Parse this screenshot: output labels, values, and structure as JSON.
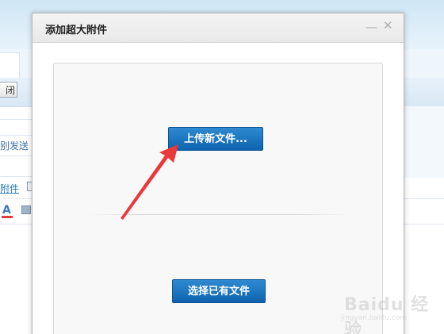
{
  "background_page": {
    "close_button_label": "闭",
    "send_label": "别发送",
    "attachment_link": "附件"
  },
  "dialog": {
    "title": "添加超大附件",
    "minimize_icon": "minus-icon",
    "close_icon": "close-icon",
    "upload_button_label": "上传新文件...",
    "choose_button_label": "选择已有文件"
  },
  "annotation": {
    "arrow_color": "#e8393b"
  },
  "watermark": {
    "text": "Baidu 经验",
    "url": "jingyan.baidu.com"
  },
  "colors": {
    "button_blue": "#1a74bf",
    "sky": "#cfe6f5"
  }
}
